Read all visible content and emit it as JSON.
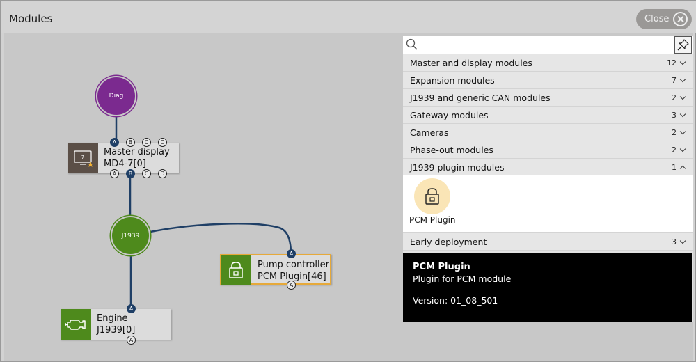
{
  "window": {
    "title": "Modules",
    "close_label": "Close"
  },
  "canvas": {
    "diag_label": "Diag",
    "j1939_label": "J1939",
    "master": {
      "name": "Master display",
      "id": "MD4-7[0]",
      "icon_text": "7"
    },
    "pump": {
      "name": "Pump controller",
      "id": "PCM Plugin[46]"
    },
    "engine": {
      "name": "Engine",
      "id": "J1939[0]"
    },
    "ports": {
      "a": "A",
      "b": "B",
      "c": "C",
      "d": "D"
    }
  },
  "panel": {
    "search_placeholder": "",
    "categories": [
      {
        "label": "Master and display modules",
        "count": "12"
      },
      {
        "label": "Expansion modules",
        "count": "7"
      },
      {
        "label": "J1939 and generic CAN modules",
        "count": "2"
      },
      {
        "label": "Gateway modules",
        "count": "3"
      },
      {
        "label": "Cameras",
        "count": "2"
      },
      {
        "label": "Phase-out modules",
        "count": "2"
      },
      {
        "label": "J1939 plugin modules",
        "count": "1"
      },
      {
        "label": "Early deployment",
        "count": "3"
      }
    ],
    "plugin": {
      "label": "PCM Plugin"
    },
    "tooltip": {
      "title": "PCM Plugin",
      "description": "Plugin for PCM module",
      "version": "Version: 01_08_501"
    }
  },
  "colors": {
    "diag": "#7b2a8f",
    "j1939": "#4e8a1c",
    "wire": "#1f3f66",
    "selected_border": "#e6a93a",
    "plugin_tile": "#fae5b6"
  }
}
